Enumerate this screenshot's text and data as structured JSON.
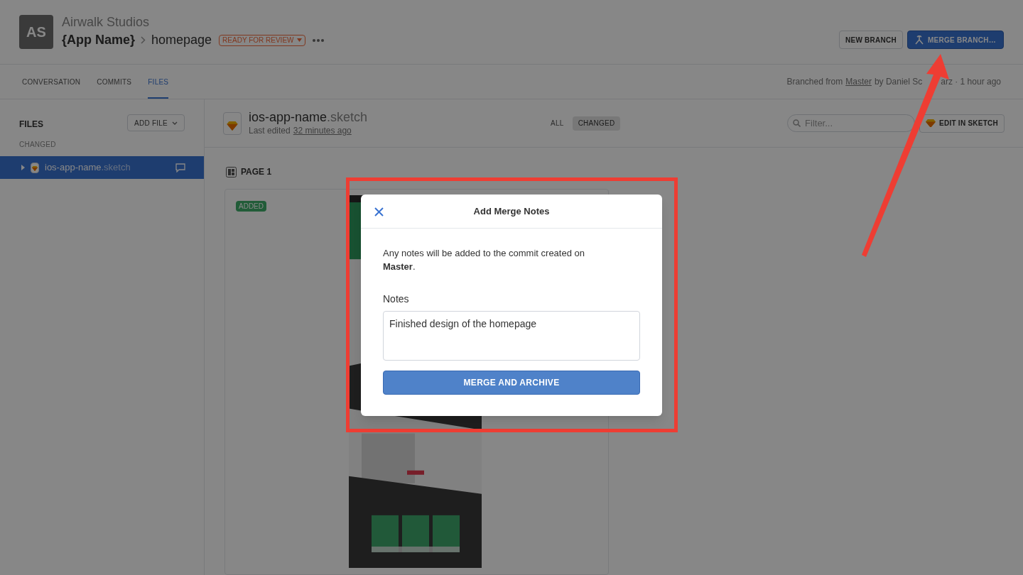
{
  "header": {
    "avatar": "AS",
    "org": "Airwalk Studios",
    "project": "{App Name}",
    "branch": "homepage",
    "status": "READY FOR REVIEW",
    "buttons": [
      {
        "kind": "secondary",
        "label": "NEW BRANCH"
      },
      {
        "kind": "primary",
        "label": "MERGE BRANCH…"
      }
    ]
  },
  "tabs": [
    {
      "label": "CONVERSATION",
      "selected": false
    },
    {
      "label": "COMMITS",
      "selected": false
    },
    {
      "label": "FILES",
      "selected": true
    }
  ],
  "branch_info": {
    "prefix": "Branched from",
    "link": "Master",
    "suffix_before": "by Daniel Sc",
    "suffix_after": "arz · 1 hour ago"
  },
  "sidebar": {
    "title": "FILES",
    "add_button": "ADD FILE",
    "section": "CHANGED",
    "files": [
      {
        "name": "ios-app-name",
        "extension": ".sketch",
        "selected": true
      }
    ]
  },
  "file": {
    "name": "ios-app-name",
    "extension": ".sketch",
    "edited_prefix": "Last edited",
    "edited_link": "32 minutes ago",
    "filters": [
      {
        "label": "ALL",
        "selected": false
      },
      {
        "label": "CHANGED",
        "selected": true
      }
    ],
    "search": {
      "placeholder": "Filter..."
    },
    "edit_button": "EDIT IN SKETCH"
  },
  "page": {
    "title": "PAGE 1",
    "artboard": {
      "badge": "ADDED",
      "kind": "picture"
    }
  },
  "modal": {
    "title": "Add Merge Notes",
    "message": "Any notes will be added to the commit created on **Master**.",
    "notes_label": "Notes",
    "notes_value": "Finished design of the homepage",
    "submit": "MERGE AND ARCHIVE"
  }
}
